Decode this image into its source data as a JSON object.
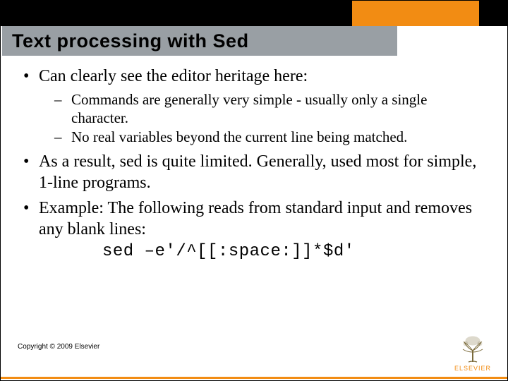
{
  "title": "Text processing with Sed",
  "bullets": [
    {
      "text": "Can clearly see the editor heritage here:",
      "sub": [
        "Commands are generally very simple - usually only a single character.",
        "No real variables beyond the current line being matched."
      ]
    },
    {
      "text": "As a result, sed is quite limited.  Generally, used most for simple, 1-line programs."
    },
    {
      "text": "Example:  The following reads from standard input and removes any blank lines:",
      "code": "sed –e'/^[[:space:]]*$d'"
    }
  ],
  "copyright": "Copyright © 2009 Elsevier",
  "logo_text": "ELSEVIER",
  "colors": {
    "accent": "#f28c13",
    "title_bg": "#999fa4"
  }
}
